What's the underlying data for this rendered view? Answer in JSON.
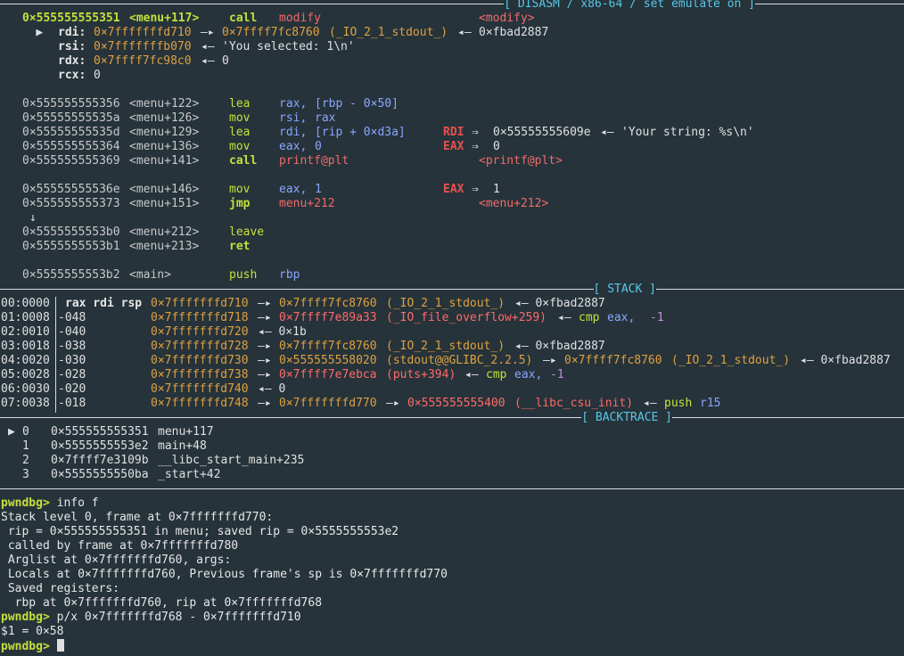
{
  "disasm_title": "[ DISASM / x86-64 / set emulate on ]",
  "stack_title": "[ STACK ]",
  "backtrace_title": "[ BACKTRACE ]",
  "disasm": {
    "current": {
      "marker": "▶",
      "addr": "0×555555555351",
      "sym": "<menu+117>",
      "mn": "call",
      "op": "modify",
      "ann": "<modify>"
    },
    "args": [
      {
        "reg": "rdi:",
        "val": "0×7fffffffd710",
        "arrow": "—▸",
        "val2": "0×7ffff7fc8760",
        "sym": "(_IO_2_1_stdout_)",
        "arrow2": "◂—",
        "val3": "0×fbad2887"
      },
      {
        "reg": "rsi:",
        "val": "0×7fffffffb070",
        "arrow": "◂—",
        "str": "'You selected: 1\\n'"
      },
      {
        "reg": "rdx:",
        "val": "0×7ffff7fc98c0",
        "arrow": "◂—",
        "str": "0"
      },
      {
        "reg": "rcx:",
        "str": "0"
      }
    ],
    "rows": [
      {
        "addr": "0×555555555356",
        "sym": "<menu+122>",
        "mn": "lea",
        "op1": "rax,",
        "op2": "[rbp - 0×50]"
      },
      {
        "addr": "0×55555555535a",
        "sym": "<menu+126>",
        "mn": "mov",
        "op1": "rsi,",
        "op2": "rax"
      },
      {
        "addr": "0×55555555535d",
        "sym": "<menu+129>",
        "mn": "lea",
        "op1": "rdi,",
        "op2": "[rip + 0×d3a]",
        "reg": "RDI",
        "arrow": "⇒",
        "v": "0×55555555609e",
        "arrow2": "◂—",
        "s": "'Your string: %s\\n'"
      },
      {
        "addr": "0×555555555364",
        "sym": "<menu+136>",
        "mn": "mov",
        "op1": "eax,",
        "op2": "0",
        "reg": "EAX",
        "arrow": "⇒",
        "v": "0"
      },
      {
        "addr": "0×555555555369",
        "sym": "<menu+141>",
        "mn": "call",
        "op1": "printf@plt",
        "ann": "<printf@plt>"
      },
      {
        "addr": "0×55555555536e",
        "sym": "<menu+146>",
        "mn": "mov",
        "op1": "eax,",
        "op2": "1",
        "reg": "EAX",
        "arrow": "⇒",
        "v": "1"
      },
      {
        "addr": "0×555555555373",
        "sym": "<menu+151>",
        "mn": "jmp",
        "op1": "menu+212",
        "ann": "<menu+212>"
      },
      {
        "down": "↓"
      },
      {
        "addr": "0×5555555553b0",
        "sym": "<menu+212>",
        "mn": "leave"
      },
      {
        "addr": "0×5555555553b1",
        "sym": "<menu+213>",
        "mn": "ret"
      },
      {
        "addr": "0×5555555553b2",
        "sym": "<main>",
        "mn": "push",
        "op1": "rbp"
      }
    ]
  },
  "stack": [
    {
      "idx": "00:0000",
      "off": "rax rdi rsp",
      "a": "0×7fffffffd710",
      "b": "0×7ffff7fc8760",
      "c": "(_IO_2_1_stdout_)",
      "d": "◂— 0×fbad2887"
    },
    {
      "idx": "01:0008",
      "off": "-048",
      "a": "0×7fffffffd718",
      "b": "0×7ffff7e89a33",
      "c": "(_IO_file_overflow+259)",
      "d": "◂—",
      "e": "cmp",
      "f": "eax,",
      "g": "-1"
    },
    {
      "idx": "02:0010",
      "off": "-040",
      "a": "0×7fffffffd720",
      "d": "◂— 0×1b"
    },
    {
      "idx": "03:0018",
      "off": "-038",
      "a": "0×7fffffffd728",
      "b": "0×7ffff7fc8760",
      "c": "(_IO_2_1_stdout_)",
      "d": "◂— 0×fbad2887"
    },
    {
      "idx": "04:0020",
      "off": "-030",
      "a": "0×7fffffffd730",
      "b": "0×555555558020",
      "c": "(stdout@@GLIBC_2.2.5)",
      "b2": "0×7ffff7fc8760",
      "c2": "(_IO_2_1_stdout_)",
      "d": "◂— 0×fbad2887"
    },
    {
      "idx": "05:0028",
      "off": "-028",
      "a": "0×7fffffffd738",
      "b": "0×7ffff7e7ebca",
      "c": "(puts+394)",
      "d": "◂—",
      "e": "cmp",
      "f": "eax,",
      "g": "-1"
    },
    {
      "idx": "06:0030",
      "off": "-020",
      "a": "0×7fffffffd740",
      "d": "◂— 0"
    },
    {
      "idx": "07:0038",
      "off": "-018",
      "a": "0×7fffffffd748",
      "b": "0×7fffffffd770",
      "b2": "0×555555555400",
      "c2": "(__libc_csu_init)",
      "d": "◂—",
      "e": "push",
      "f": "r15"
    }
  ],
  "backtrace": [
    {
      "mark": "▶",
      "n": "0",
      "addr": "0×555555555351",
      "fn": "menu+117"
    },
    {
      "mark": "",
      "n": "1",
      "addr": "0×5555555553e2",
      "fn": "main+48"
    },
    {
      "mark": "",
      "n": "2",
      "addr": "0×7ffff7e3109b",
      "fn": "__libc_start_main+235"
    },
    {
      "mark": "",
      "n": "3",
      "addr": "0×5555555550ba",
      "fn": "_start+42"
    }
  ],
  "console": {
    "prompt": "pwndbg>",
    "cmd1": " info f",
    "out": [
      "Stack level 0, frame at 0×7fffffffd770:",
      " rip = 0×555555555351 in menu; saved rip = 0×5555555553e2",
      " called by frame at 0×7fffffffd780",
      " Arglist at 0×7fffffffd760, args:",
      " Locals at 0×7fffffffd760, Previous frame's sp is 0×7fffffffd770",
      " Saved registers:",
      "  rbp at 0×7fffffffd760, rip at 0×7fffffffd768"
    ],
    "cmd2": " p/x 0×7fffffffd768 - 0×7fffffffd710",
    "result": "$1 = 0×58"
  }
}
